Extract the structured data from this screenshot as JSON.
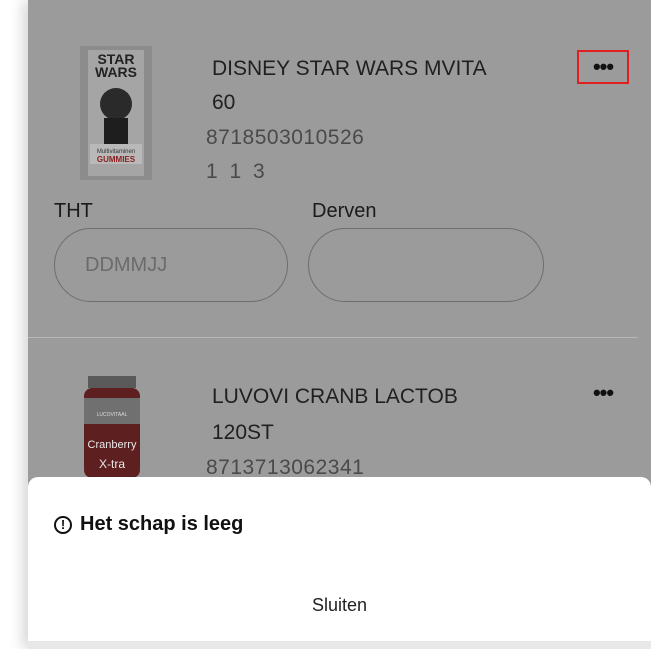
{
  "products": [
    {
      "name": "DISNEY STAR WARS MVITA",
      "size": "60",
      "ean": "8718503010526",
      "location": "1 1 3",
      "more_label": "•••",
      "fields": {
        "tht_label": "THT",
        "tht_placeholder": "DDMMJJ",
        "derven_label": "Derven",
        "derven_value": ""
      },
      "thumb": {
        "brand_text": "STAR WARS",
        "sub_text": "Multivitaminen",
        "label_text": "GUMMIES"
      }
    },
    {
      "name": "LUVOVI CRANB LACTOB",
      "size": "120ST",
      "ean": "8713713062341",
      "more_label": "•••",
      "thumb": {
        "brand_text": "LUCOVITAAL",
        "label_text": "Cranberry",
        "sub_text": "X-tra"
      }
    }
  ],
  "sheet": {
    "title": "Het schap is leeg",
    "close_label": "Sluiten"
  },
  "colors": {
    "overlay": "#9b9b9b",
    "highlight": "#e02020",
    "sheet_bg": "#ffffff"
  }
}
